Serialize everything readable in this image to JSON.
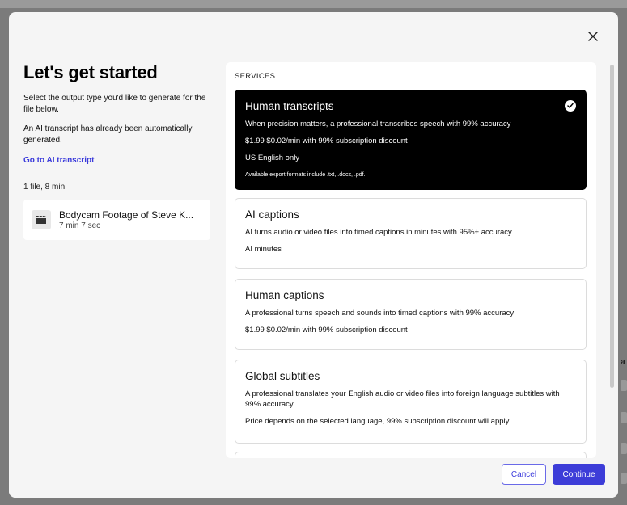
{
  "modal": {
    "title": "Let's get started",
    "description_1": "Select the output type you'd like to generate for the file below.",
    "description_2": "An AI transcript has already been automatically generated.",
    "ai_transcript_link": "Go to AI transcript",
    "files_summary": "1 file, 8 min",
    "file": {
      "name": "Bodycam Footage of Steve K...",
      "duration": "7 min 7 sec"
    },
    "services_label": "SERVICES",
    "services": [
      {
        "title": "Human transcripts",
        "description": "When precision matters, a professional transcribes speech with 99% accuracy",
        "old_price": "$1.99",
        "price_text": "$0.02/min with 99% subscription discount",
        "extra": "US English only",
        "note": "Available export formats include .txt, .docx, .pdf.",
        "selected": true
      },
      {
        "title": "AI captions",
        "description": "AI turns audio or video files into timed captions in minutes with 95%+ accuracy",
        "extra": "AI minutes",
        "selected": false
      },
      {
        "title": "Human captions",
        "description": "A professional turns speech and sounds into timed captions with 99% accuracy",
        "old_price": "$1.99",
        "price_text": "$0.02/min with 99% subscription discount",
        "selected": false
      },
      {
        "title": "Global subtitles",
        "description": "A professional translates your English audio or video files into foreign language subtitles with 99% accuracy",
        "extra": "Price depends on the selected language, 99% subscription discount will apply",
        "selected": false
      }
    ],
    "cancel_label": "Cancel",
    "continue_label": "Continue"
  },
  "background": {
    "right_text": "a"
  },
  "colors": {
    "accent": "#3d3dd8",
    "link": "#3b3bdb",
    "selected_card": "#000000"
  },
  "icons": [
    "close-icon",
    "film-icon",
    "check-circle-icon"
  ]
}
